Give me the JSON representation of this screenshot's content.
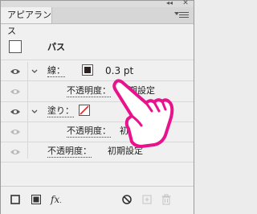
{
  "window": {
    "collapse_glyph": "◂◂",
    "close_glyph": "✕"
  },
  "panel": {
    "tab_label": "アピアランス",
    "menu_icon": "panel-menu-icon"
  },
  "rows": {
    "path_label": "パス",
    "stroke_label": "線：",
    "stroke_value": "0.3 pt",
    "stroke_opacity_label": "不透明度：",
    "stroke_opacity_value": "初期設定",
    "fill_label": "塗り：",
    "fill_opacity_label": "不透明度：",
    "fill_opacity_value": "初",
    "opacity_label": "不透明度：",
    "opacity_value": "初期設定"
  },
  "footer": {
    "fx_label": "fx",
    "icons": [
      "add-new-stroke-icon",
      "add-new-fill-icon",
      "add-effect-icon",
      "clear-appearance-icon",
      "duplicate-item-icon",
      "delete-item-icon"
    ]
  },
  "colors": {
    "stroke_swatch": "#2b2020",
    "fill_none_slash": "#e0262a",
    "hand_outline": "#e8128c",
    "panel_bg": "#f0f0f0"
  },
  "overlay": {
    "pointing_hand_icon": "pointing-hand-icon"
  }
}
